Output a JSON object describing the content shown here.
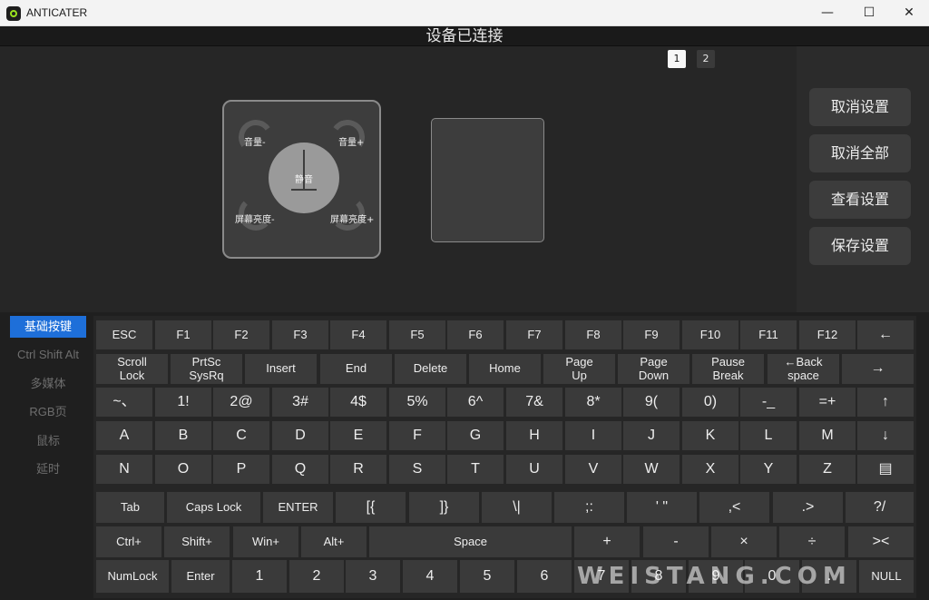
{
  "window": {
    "title": "ANTICATER",
    "min_glyph": "—",
    "max_glyph": "☐",
    "close_glyph": "✕"
  },
  "device_status": "设备已连接",
  "pages": [
    "1",
    "2"
  ],
  "knob": {
    "center": "静音",
    "top_left": "音量-",
    "top_right": "音量+",
    "bottom_left": "屏幕亮度-",
    "bottom_right": "屏幕亮度+"
  },
  "settings": {
    "cancel_setting": "取消设置",
    "cancel_all": "取消全部",
    "view_setting": "查看设置",
    "save_setting": "保存设置"
  },
  "categories": [
    "基础按键",
    "Ctrl Shift Alt",
    "多媒体",
    "RGB页",
    "鼠标",
    "延时"
  ],
  "keyboard": {
    "row1": [
      "ESC",
      "F1",
      "F2",
      "F3",
      "F4",
      "F5",
      "F6",
      "F7",
      "F8",
      "F9",
      "F10",
      "F11",
      "F12",
      "←"
    ],
    "row2": [
      "Scroll\nLock",
      "PrtSc\nSysRq",
      "Insert",
      "End",
      "Delete",
      "Home",
      "Page\nUp",
      "Page\nDown",
      "Pause\nBreak",
      "←Back\nspace",
      "→"
    ],
    "row3": [
      "~、",
      "1!",
      "2@",
      "3#",
      "4$",
      "5%",
      "6^",
      "7&",
      "8*",
      "9(",
      "0)",
      "-_",
      "=+",
      "↑"
    ],
    "row4": [
      "A",
      "B",
      "C",
      "D",
      "E",
      "F",
      "G",
      "H",
      "I",
      "J",
      "K",
      "L",
      "M",
      "↓"
    ],
    "row5": [
      "N",
      "O",
      "P",
      "Q",
      "R",
      "S",
      "T",
      "U",
      "V",
      "W",
      "X",
      "Y",
      "Z",
      "▤"
    ],
    "row6": [
      "Tab",
      "Caps Lock",
      "ENTER",
      "[{",
      "]}",
      "\\|",
      ";:",
      "' \"",
      ",<",
      ".>",
      "?/"
    ],
    "row7": [
      "Ctrl+",
      "Shift+",
      "Win+",
      "Alt+",
      "Space",
      "+",
      "-",
      "×",
      "÷",
      "><"
    ],
    "row8": [
      "NumLock",
      "Enter",
      "1",
      "2",
      "3",
      "4",
      "5",
      "6",
      "7",
      "8",
      "9",
      "0",
      ".",
      "NULL"
    ]
  },
  "watermark": "WEISTANG.COM"
}
